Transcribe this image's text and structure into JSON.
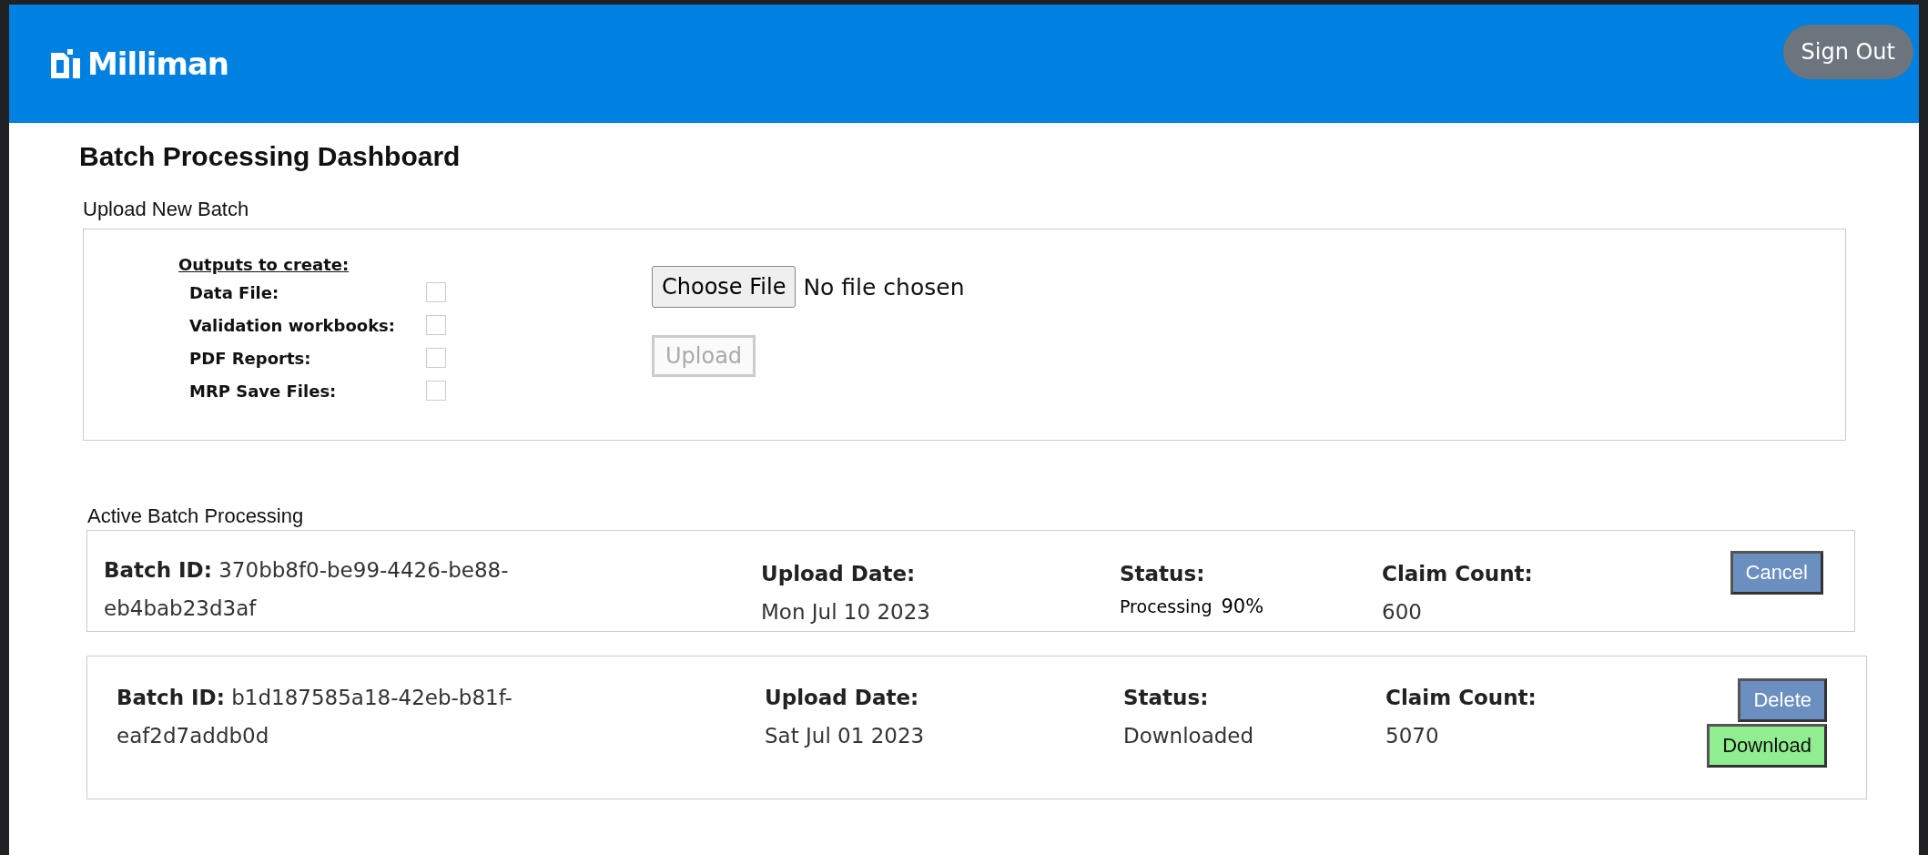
{
  "header": {
    "brand": "Milliman",
    "sign_out": "Sign Out"
  },
  "title": "Batch Processing Dashboard",
  "upload": {
    "heading": "Upload New Batch",
    "outputs_heading": "Outputs to create:",
    "outputs": [
      {
        "label": "Data File:",
        "checked": false
      },
      {
        "label": "Validation workbooks:",
        "checked": false
      },
      {
        "label": "PDF Reports:",
        "checked": false
      },
      {
        "label": "MRP Save Files:",
        "checked": false
      }
    ],
    "choose_file": "Choose File",
    "file_status": "No file chosen",
    "upload_button": {
      "label": "Upload",
      "disabled": true
    }
  },
  "active": {
    "heading": "Active Batch Processing",
    "batches": [
      {
        "id_label": "Batch ID:",
        "id": "370bb8f0-be99-4426-be88-eb4bab23d3af",
        "date_label": "Upload Date:",
        "date": "Mon Jul 10 2023",
        "status_label": "Status:",
        "status": "Processing",
        "progress": "90%",
        "count_label": "Claim Count:",
        "count": "600",
        "buttons": [
          {
            "label": "Cancel",
            "kind": "cancel"
          }
        ]
      },
      {
        "id_label": "Batch ID:",
        "id": "b1d187585a18-42eb-b81f-eaf2d7addb0d",
        "date_label": "Upload Date:",
        "date": "Sat  Jul  01 2023",
        "status_label": "Status:",
        "status": "Downloaded",
        "count_label": "Claim Count:",
        "count": "5070",
        "buttons": [
          {
            "label": "Delete",
            "kind": "delete"
          },
          {
            "label": "Download",
            "kind": "download"
          }
        ]
      }
    ]
  }
}
